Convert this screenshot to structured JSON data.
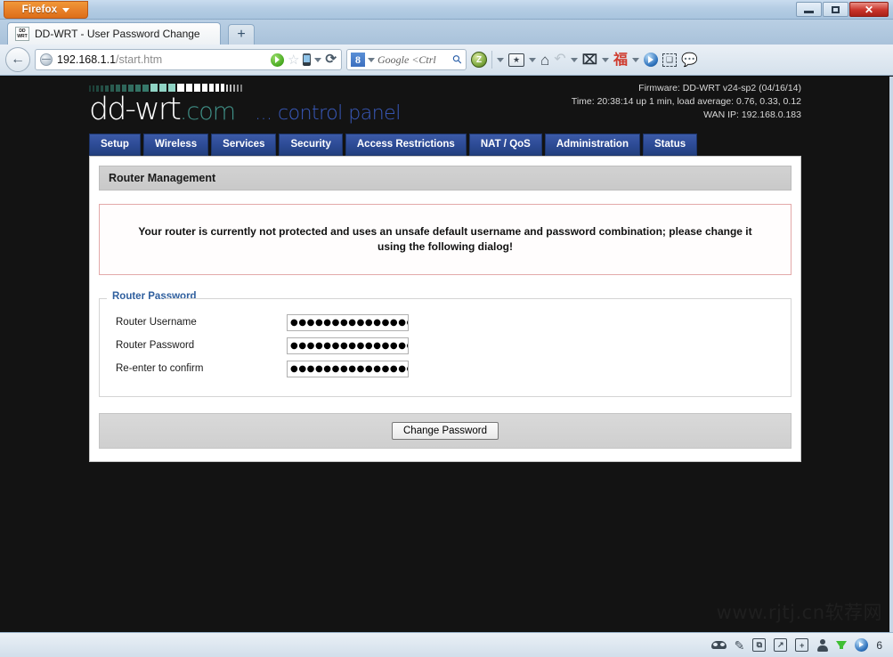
{
  "browser": {
    "app_menu_label": "Firefox",
    "window_controls": {
      "minimize": "minimize",
      "restore": "restore",
      "close": "✕"
    },
    "tab": {
      "favicon_line1": "DD",
      "favicon_line2": "WRT",
      "title": "DD-WRT - User Password Change"
    },
    "new_tab_label": "+",
    "back_button_glyph": "←",
    "url": {
      "host": "192.168.1.1",
      "path": "/start.htm"
    },
    "search": {
      "engine_letter": "8",
      "placeholder": "Google <Ctrl",
      "magnifier_glyph": "⚲"
    },
    "toolbar_icons": [
      "zotero-icon",
      "bookmark-icon",
      "home-icon",
      "undo-icon",
      "crop-icon",
      "fu-character-icon",
      "media-player-icon",
      "screenshot-icon",
      "speech-bubble-icon"
    ],
    "home_glyph": "⌂",
    "undo_glyph": "↶",
    "crop_glyph": "⌧",
    "fu_glyph": "福",
    "bookmark_glyph": "★",
    "zotero_glyph": "Z",
    "dashed_glyph": "❐",
    "speech_glyph": "💬",
    "reload_glyph": "⟳"
  },
  "statusbar": {
    "icons": [
      "mask-icon",
      "brush-icon",
      "copy-icon",
      "share-icon",
      "add-box-icon",
      "person-icon",
      "download-icon",
      "media-orb-icon"
    ],
    "brush_glyph": "✒",
    "copy_glyph": "⧉",
    "share_glyph": "↗",
    "addbox_glyph": "+",
    "count": "6"
  },
  "ddwrt": {
    "logo": {
      "name": "dd-wrt",
      "tld": ".com",
      "tagline": "... control panel"
    },
    "info": {
      "firmware": "Firmware: DD-WRT v24-sp2 (04/16/14)",
      "time": "Time: 20:38:14 up 1 min, load average: 0.76, 0.33, 0.12",
      "wan_ip": "WAN IP: 192.168.0.183"
    },
    "nav_tabs": [
      {
        "label": "Setup"
      },
      {
        "label": "Wireless"
      },
      {
        "label": "Services"
      },
      {
        "label": "Security"
      },
      {
        "label": "Access Restrictions"
      },
      {
        "label": "NAT / QoS"
      },
      {
        "label": "Administration"
      },
      {
        "label": "Status"
      }
    ],
    "section_title": "Router Management",
    "warning": "Your router is currently not protected and uses an unsafe default username and password combination; please change it using the following dialog!",
    "form": {
      "legend": "Router Password",
      "fields": [
        {
          "label": "Router Username",
          "value": "●●●●●●●●●●●●●●●"
        },
        {
          "label": "Router Password",
          "value": "●●●●●●●●●●●●●●●"
        },
        {
          "label": "Re-enter to confirm",
          "value": "●●●●●●●●●●●●●●●"
        }
      ]
    },
    "submit_label": "Change Password"
  },
  "watermark": "www.rjtj.cn软荐网",
  "colors": {
    "nav_tab": "#2d4b96",
    "page_background": "#131313",
    "warning_border": "#e3a9a9",
    "legend_text": "#2f5f9e",
    "logo_com": "#3f8f86",
    "logo_tagline": "#3a5bbf"
  }
}
